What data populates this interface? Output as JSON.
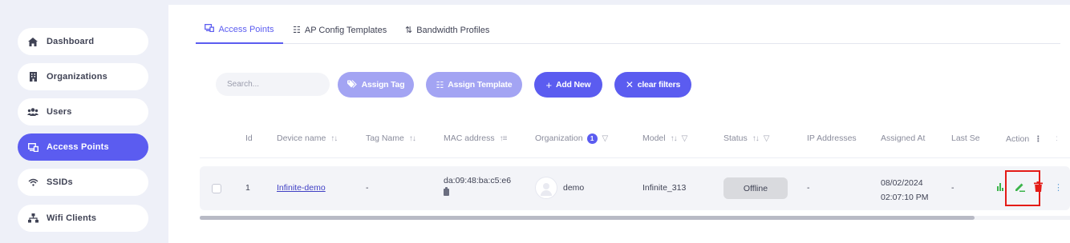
{
  "sidebar": {
    "items": [
      {
        "label": "Dashboard",
        "icon": "home-icon"
      },
      {
        "label": "Organizations",
        "icon": "building-icon"
      },
      {
        "label": "Users",
        "icon": "users-icon"
      },
      {
        "label": "Access Points",
        "icon": "access-point-icon",
        "active": true
      },
      {
        "label": "SSIDs",
        "icon": "wifi-icon"
      },
      {
        "label": "Wifi Clients",
        "icon": "network-icon"
      }
    ]
  },
  "tabs": [
    {
      "label": "Access Points",
      "active": true
    },
    {
      "label": "AP Config Templates"
    },
    {
      "label": "Bandwidth Profiles"
    }
  ],
  "toolbar": {
    "search_placeholder": "Search...",
    "assign_tag": "Assign Tag",
    "assign_template": "Assign Template",
    "add_new": "Add New",
    "clear_filters": "clear filters"
  },
  "table": {
    "headers": {
      "id": "Id",
      "device_name": "Device name",
      "tag_name": "Tag Name",
      "mac_address": "MAC address",
      "organization": "Organization",
      "organization_badge": "1",
      "model": "Model",
      "status": "Status",
      "ip_addresses": "IP Addresses",
      "assigned_at": "Assigned At",
      "last_seen": "Last Se",
      "action": "Action"
    },
    "rows": [
      {
        "id": "1",
        "device_name": "Infinite-demo",
        "tag_name": "-",
        "mac_address": "da:09:48:ba:c5:e6",
        "organization": "demo",
        "model": "Infinite_313",
        "status": "Offline",
        "ip_addresses": "-",
        "assigned_date": "08/02/2024",
        "assigned_time": "02:07:10 PM",
        "last_seen": "-"
      }
    ]
  },
  "colors": {
    "primary": "#5b5cf0",
    "primary_light": "#a3a4f3",
    "highlight": "#e41b17",
    "edit": "#3cb44b",
    "delete": "#e41b17"
  }
}
